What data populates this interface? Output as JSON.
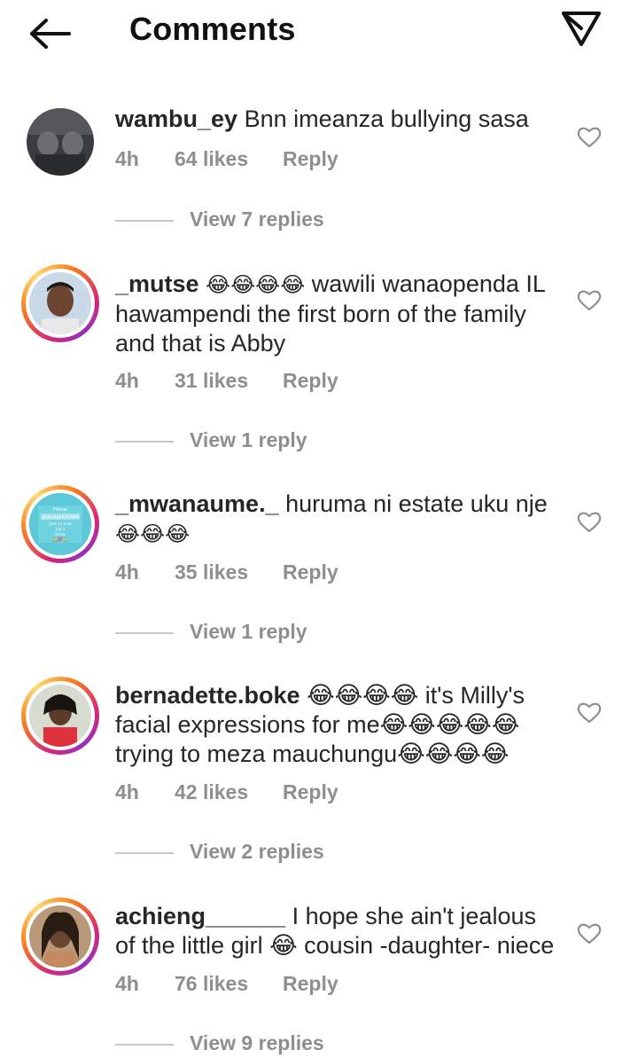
{
  "header": {
    "title": "Comments",
    "back_icon": "arrow-left-icon",
    "send_icon": "paper-plane-icon"
  },
  "comments": [
    {
      "username": "wambu_ey",
      "text": "Bnn imeanza bullying sasa",
      "time": "4h",
      "likes": "64 likes",
      "reply": "Reply",
      "replies": "View 7 replies",
      "story_ring": false
    },
    {
      "username": "_mutse",
      "text_before": "😂😂😂😂",
      "text": " wawili wanaopenda IL hawampendi the first born of the family and that is Abby",
      "time": "4h",
      "likes": "31 likes",
      "reply": "Reply",
      "replies": "View 1 reply",
      "story_ring": true
    },
    {
      "username": "_mwanaume._",
      "text": " huruma ni estate uku nje",
      "emoji_line": "😂😂😂",
      "time": "4h",
      "likes": "35 likes",
      "reply": "Reply",
      "replies": "View 1 reply",
      "story_ring": true,
      "avatar_text": [
        "Follow",
        "@otungamichael",
        "Just vs Live",
        "Let's",
        "Grow",
        "🙏💯🙏"
      ]
    },
    {
      "username": "bernadette.boke",
      "text": " 😂😂😂😂 it's Milly's facial expressions for me😂😂😂😂😂 trying to meza mauchungu😂😂😂😂",
      "time": "4h",
      "likes": "42 likes",
      "reply": "Reply",
      "replies": "View 2 replies",
      "story_ring": true
    },
    {
      "username": "achieng______",
      "text": " I hope she ain't jealous of the little girl 😂 cousin -daughter- niece",
      "time": "4h",
      "likes": "76 likes",
      "reply": "Reply",
      "replies": "View 9 replies",
      "story_ring": true
    }
  ],
  "colors": {
    "text": "#262626",
    "muted": "#8e8e8e",
    "divider": "#c7c7c7"
  }
}
